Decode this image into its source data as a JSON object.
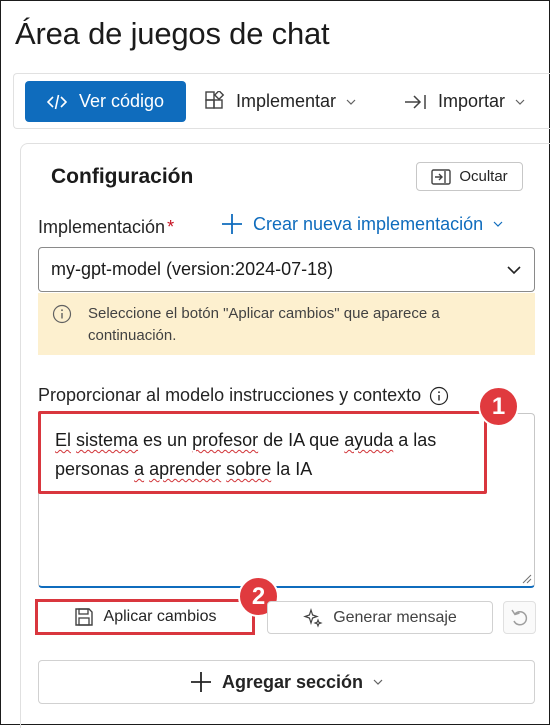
{
  "page": {
    "title": "Área de juegos de chat"
  },
  "toolbar": {
    "view_code": "Ver código",
    "deploy": "Implementar",
    "import": "Importar"
  },
  "config": {
    "title": "Configuración",
    "hide": "Ocultar",
    "deployment_label": "Implementación",
    "required_mark": "*",
    "create_deployment": "Crear nueva implementación",
    "selected_model": "my-gpt-model (version:2024-07-18)",
    "notice": "Seleccione el botón \"Aplicar cambios\" que aparece a continuación.",
    "instructions_label": "Proporcionar al modelo instrucciones y contexto",
    "system_message": "El sistema es un profesor de IA que ayuda a las personas a aprender sobre la IA",
    "apply_changes": "Aplicar cambios",
    "generate_prompt": "Generar mensaje",
    "add_section": "Agregar sección"
  },
  "annotations": {
    "badge_1": "1",
    "badge_2": "2",
    "highlight_color": "#d9363e"
  },
  "colors": {
    "primary": "#0f6cbd",
    "notice_bg": "#fdf0cf",
    "required": "#c50f1f"
  }
}
